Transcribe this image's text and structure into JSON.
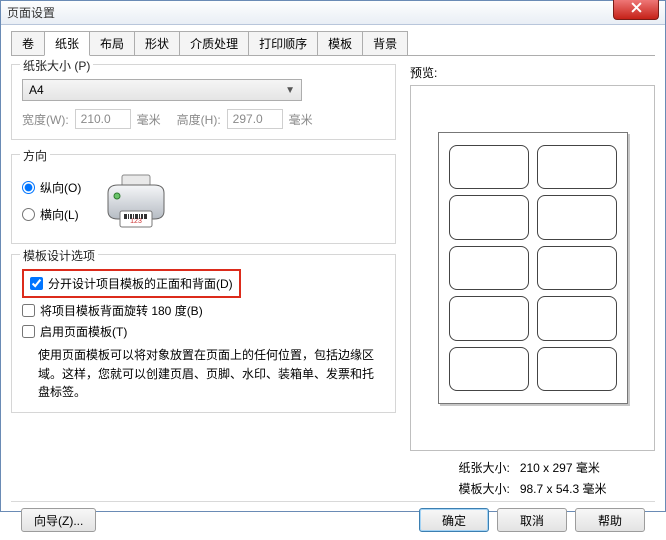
{
  "window": {
    "title": "页面设置"
  },
  "tabs": [
    "卷",
    "纸张",
    "布局",
    "形状",
    "介质处理",
    "打印顺序",
    "模板",
    "背景"
  ],
  "active_tab_index": 1,
  "paper_size": {
    "group_label": "纸张大小 (P)",
    "selected": "A4",
    "width_label": "宽度(W):",
    "width_value": "210.0",
    "width_unit": "毫米",
    "height_label": "高度(H):",
    "height_value": "297.0",
    "height_unit": "毫米"
  },
  "orientation": {
    "group_label": "方向",
    "portrait_label": "纵向(O)",
    "landscape_label": "横向(L)",
    "selected": "portrait"
  },
  "template_opts": {
    "group_label": "模板设计选项",
    "separate_front_back_label": "分开设计项目模板的正面和背面(D)",
    "separate_front_back_checked": true,
    "rotate_back_label": "将项目模板背面旋转 180 度(B)",
    "rotate_back_checked": false,
    "enable_page_template_label": "启用页面模板(T)",
    "enable_page_template_checked": false,
    "help_text": "使用页面模板可以将对象放置在页面上的任何位置，包括边缘区域。这样，您就可以创建页眉、页脚、水印、装箱单、发票和托盘标签。"
  },
  "preview": {
    "label": "预览:",
    "paper_size_label": "纸张大小:",
    "paper_size_value": "210 x 297 毫米",
    "template_size_label": "模板大小:",
    "template_size_value": "98.7 x 54.3 毫米"
  },
  "buttons": {
    "wizard": "向导(Z)...",
    "ok": "确定",
    "cancel": "取消",
    "help": "帮助"
  }
}
